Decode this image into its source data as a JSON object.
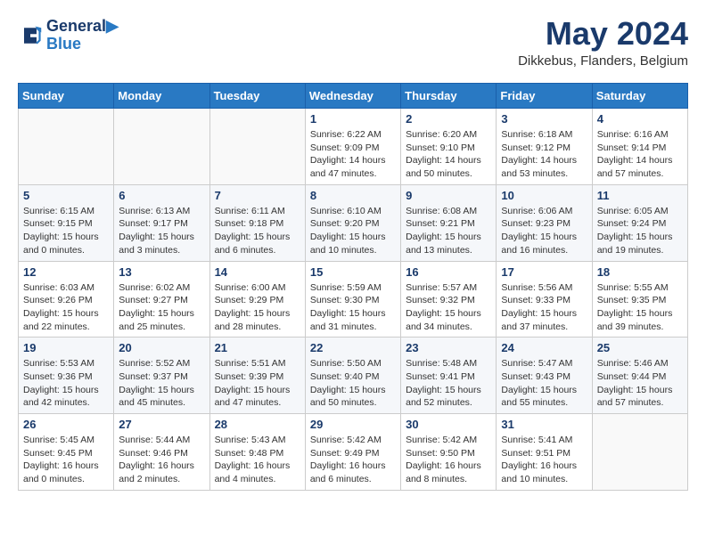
{
  "header": {
    "logo": {
      "line1": "General",
      "line2": "Blue"
    },
    "title": "May 2024",
    "location": "Dikkebus, Flanders, Belgium"
  },
  "weekdays": [
    "Sunday",
    "Monday",
    "Tuesday",
    "Wednesday",
    "Thursday",
    "Friday",
    "Saturday"
  ],
  "weeks": [
    [
      {
        "day": "",
        "sunrise": "",
        "sunset": "",
        "daylight": ""
      },
      {
        "day": "",
        "sunrise": "",
        "sunset": "",
        "daylight": ""
      },
      {
        "day": "",
        "sunrise": "",
        "sunset": "",
        "daylight": ""
      },
      {
        "day": "1",
        "sunrise": "Sunrise: 6:22 AM",
        "sunset": "Sunset: 9:09 PM",
        "daylight": "Daylight: 14 hours and 47 minutes."
      },
      {
        "day": "2",
        "sunrise": "Sunrise: 6:20 AM",
        "sunset": "Sunset: 9:10 PM",
        "daylight": "Daylight: 14 hours and 50 minutes."
      },
      {
        "day": "3",
        "sunrise": "Sunrise: 6:18 AM",
        "sunset": "Sunset: 9:12 PM",
        "daylight": "Daylight: 14 hours and 53 minutes."
      },
      {
        "day": "4",
        "sunrise": "Sunrise: 6:16 AM",
        "sunset": "Sunset: 9:14 PM",
        "daylight": "Daylight: 14 hours and 57 minutes."
      }
    ],
    [
      {
        "day": "5",
        "sunrise": "Sunrise: 6:15 AM",
        "sunset": "Sunset: 9:15 PM",
        "daylight": "Daylight: 15 hours and 0 minutes."
      },
      {
        "day": "6",
        "sunrise": "Sunrise: 6:13 AM",
        "sunset": "Sunset: 9:17 PM",
        "daylight": "Daylight: 15 hours and 3 minutes."
      },
      {
        "day": "7",
        "sunrise": "Sunrise: 6:11 AM",
        "sunset": "Sunset: 9:18 PM",
        "daylight": "Daylight: 15 hours and 6 minutes."
      },
      {
        "day": "8",
        "sunrise": "Sunrise: 6:10 AM",
        "sunset": "Sunset: 9:20 PM",
        "daylight": "Daylight: 15 hours and 10 minutes."
      },
      {
        "day": "9",
        "sunrise": "Sunrise: 6:08 AM",
        "sunset": "Sunset: 9:21 PM",
        "daylight": "Daylight: 15 hours and 13 minutes."
      },
      {
        "day": "10",
        "sunrise": "Sunrise: 6:06 AM",
        "sunset": "Sunset: 9:23 PM",
        "daylight": "Daylight: 15 hours and 16 minutes."
      },
      {
        "day": "11",
        "sunrise": "Sunrise: 6:05 AM",
        "sunset": "Sunset: 9:24 PM",
        "daylight": "Daylight: 15 hours and 19 minutes."
      }
    ],
    [
      {
        "day": "12",
        "sunrise": "Sunrise: 6:03 AM",
        "sunset": "Sunset: 9:26 PM",
        "daylight": "Daylight: 15 hours and 22 minutes."
      },
      {
        "day": "13",
        "sunrise": "Sunrise: 6:02 AM",
        "sunset": "Sunset: 9:27 PM",
        "daylight": "Daylight: 15 hours and 25 minutes."
      },
      {
        "day": "14",
        "sunrise": "Sunrise: 6:00 AM",
        "sunset": "Sunset: 9:29 PM",
        "daylight": "Daylight: 15 hours and 28 minutes."
      },
      {
        "day": "15",
        "sunrise": "Sunrise: 5:59 AM",
        "sunset": "Sunset: 9:30 PM",
        "daylight": "Daylight: 15 hours and 31 minutes."
      },
      {
        "day": "16",
        "sunrise": "Sunrise: 5:57 AM",
        "sunset": "Sunset: 9:32 PM",
        "daylight": "Daylight: 15 hours and 34 minutes."
      },
      {
        "day": "17",
        "sunrise": "Sunrise: 5:56 AM",
        "sunset": "Sunset: 9:33 PM",
        "daylight": "Daylight: 15 hours and 37 minutes."
      },
      {
        "day": "18",
        "sunrise": "Sunrise: 5:55 AM",
        "sunset": "Sunset: 9:35 PM",
        "daylight": "Daylight: 15 hours and 39 minutes."
      }
    ],
    [
      {
        "day": "19",
        "sunrise": "Sunrise: 5:53 AM",
        "sunset": "Sunset: 9:36 PM",
        "daylight": "Daylight: 15 hours and 42 minutes."
      },
      {
        "day": "20",
        "sunrise": "Sunrise: 5:52 AM",
        "sunset": "Sunset: 9:37 PM",
        "daylight": "Daylight: 15 hours and 45 minutes."
      },
      {
        "day": "21",
        "sunrise": "Sunrise: 5:51 AM",
        "sunset": "Sunset: 9:39 PM",
        "daylight": "Daylight: 15 hours and 47 minutes."
      },
      {
        "day": "22",
        "sunrise": "Sunrise: 5:50 AM",
        "sunset": "Sunset: 9:40 PM",
        "daylight": "Daylight: 15 hours and 50 minutes."
      },
      {
        "day": "23",
        "sunrise": "Sunrise: 5:48 AM",
        "sunset": "Sunset: 9:41 PM",
        "daylight": "Daylight: 15 hours and 52 minutes."
      },
      {
        "day": "24",
        "sunrise": "Sunrise: 5:47 AM",
        "sunset": "Sunset: 9:43 PM",
        "daylight": "Daylight: 15 hours and 55 minutes."
      },
      {
        "day": "25",
        "sunrise": "Sunrise: 5:46 AM",
        "sunset": "Sunset: 9:44 PM",
        "daylight": "Daylight: 15 hours and 57 minutes."
      }
    ],
    [
      {
        "day": "26",
        "sunrise": "Sunrise: 5:45 AM",
        "sunset": "Sunset: 9:45 PM",
        "daylight": "Daylight: 16 hours and 0 minutes."
      },
      {
        "day": "27",
        "sunrise": "Sunrise: 5:44 AM",
        "sunset": "Sunset: 9:46 PM",
        "daylight": "Daylight: 16 hours and 2 minutes."
      },
      {
        "day": "28",
        "sunrise": "Sunrise: 5:43 AM",
        "sunset": "Sunset: 9:48 PM",
        "daylight": "Daylight: 16 hours and 4 minutes."
      },
      {
        "day": "29",
        "sunrise": "Sunrise: 5:42 AM",
        "sunset": "Sunset: 9:49 PM",
        "daylight": "Daylight: 16 hours and 6 minutes."
      },
      {
        "day": "30",
        "sunrise": "Sunrise: 5:42 AM",
        "sunset": "Sunset: 9:50 PM",
        "daylight": "Daylight: 16 hours and 8 minutes."
      },
      {
        "day": "31",
        "sunrise": "Sunrise: 5:41 AM",
        "sunset": "Sunset: 9:51 PM",
        "daylight": "Daylight: 16 hours and 10 minutes."
      },
      {
        "day": "",
        "sunrise": "",
        "sunset": "",
        "daylight": ""
      }
    ]
  ]
}
